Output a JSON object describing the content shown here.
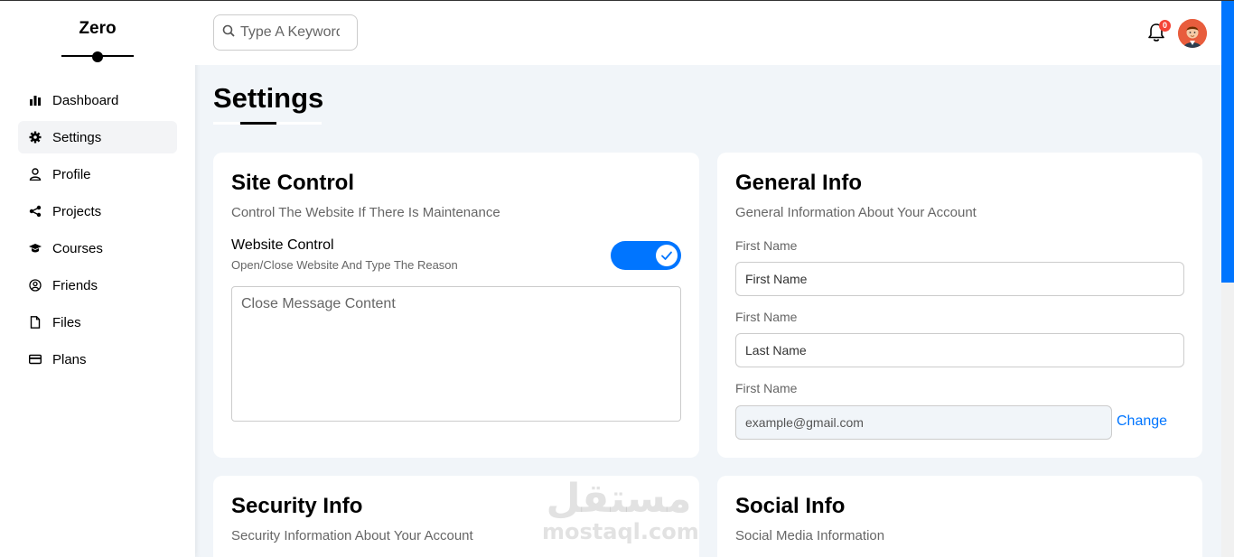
{
  "brand": {
    "name": "Zero"
  },
  "sidebar": {
    "items": [
      {
        "label": "Dashboard",
        "icon": "chart-bar-icon"
      },
      {
        "label": "Settings",
        "icon": "gear-icon"
      },
      {
        "label": "Profile",
        "icon": "user-icon"
      },
      {
        "label": "Projects",
        "icon": "share-icon"
      },
      {
        "label": "Courses",
        "icon": "graduation-cap-icon"
      },
      {
        "label": "Friends",
        "icon": "user-circle-icon"
      },
      {
        "label": "Files",
        "icon": "file-icon"
      },
      {
        "label": "Plans",
        "icon": "credit-card-icon"
      }
    ],
    "active": "Settings"
  },
  "header": {
    "search_placeholder": "Type A Keyword",
    "notification_count": "0"
  },
  "page": {
    "title": "Settings"
  },
  "site_control": {
    "title": "Site Control",
    "description": "Control The Website If There Is Maintenance",
    "control_label": "Website Control",
    "control_sub": "Open/Close Website And Type The Reason",
    "toggle_on": true,
    "message_placeholder": "Close Message Content"
  },
  "general_info": {
    "title": "General Info",
    "description": "General Information About Your Account",
    "fields": [
      {
        "label": "First Name",
        "placeholder": "First Name"
      },
      {
        "label": "First Name",
        "placeholder": "Last Name"
      },
      {
        "label": "First Name",
        "placeholder": "example@gmail.com"
      }
    ],
    "change_label": "Change"
  },
  "security_info": {
    "title": "Security Info",
    "description": "Security Information About Your Account"
  },
  "social_info": {
    "title": "Social Info",
    "description": "Social Media Information"
  },
  "watermark": {
    "arabic": "مستقل",
    "latin": "mostaql.com"
  },
  "colors": {
    "accent": "#0075ff",
    "background": "#f1f5f9",
    "badge": "#f44336"
  }
}
